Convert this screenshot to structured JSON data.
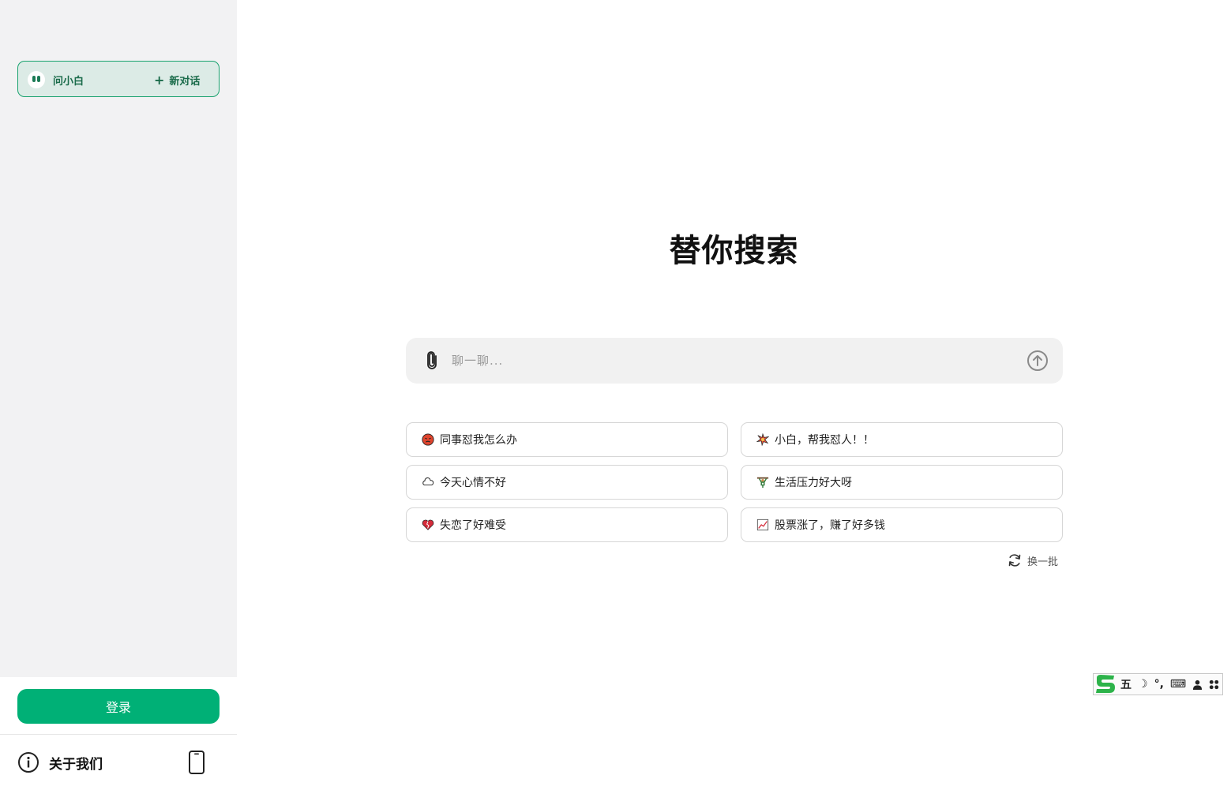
{
  "sidebar": {
    "chat_label": "问小白",
    "new_chat_label": "新对话",
    "login_label": "登录",
    "about_label": "关于我们"
  },
  "main": {
    "title": "替你搜索",
    "input_placeholder": "聊一聊...",
    "suggestions": [
      {
        "emoji": "😡",
        "text": "同事怼我怎么办"
      },
      {
        "emoji": "💢",
        "text": "小白，帮我怼人！！"
      },
      {
        "emoji": "☁",
        "text": "今天心情不好"
      },
      {
        "emoji": "🏋",
        "text": "生活压力好大呀"
      },
      {
        "emoji": "💔",
        "text": "失恋了好难受"
      },
      {
        "emoji": "📈",
        "text": "股票涨了，赚了好多钱"
      }
    ],
    "refresh_label": "换一批"
  },
  "ime": {
    "logo": "S",
    "mode": "五",
    "moon": "☽",
    "punct": "°,",
    "keyboard": "⌨",
    "user": "👤",
    "grid": "⁘"
  },
  "colors": {
    "accent": "#00b076",
    "pill_bg": "#dcebe6",
    "pill_border": "#1aa36f",
    "sidebar_bg": "#f2f2f3"
  }
}
